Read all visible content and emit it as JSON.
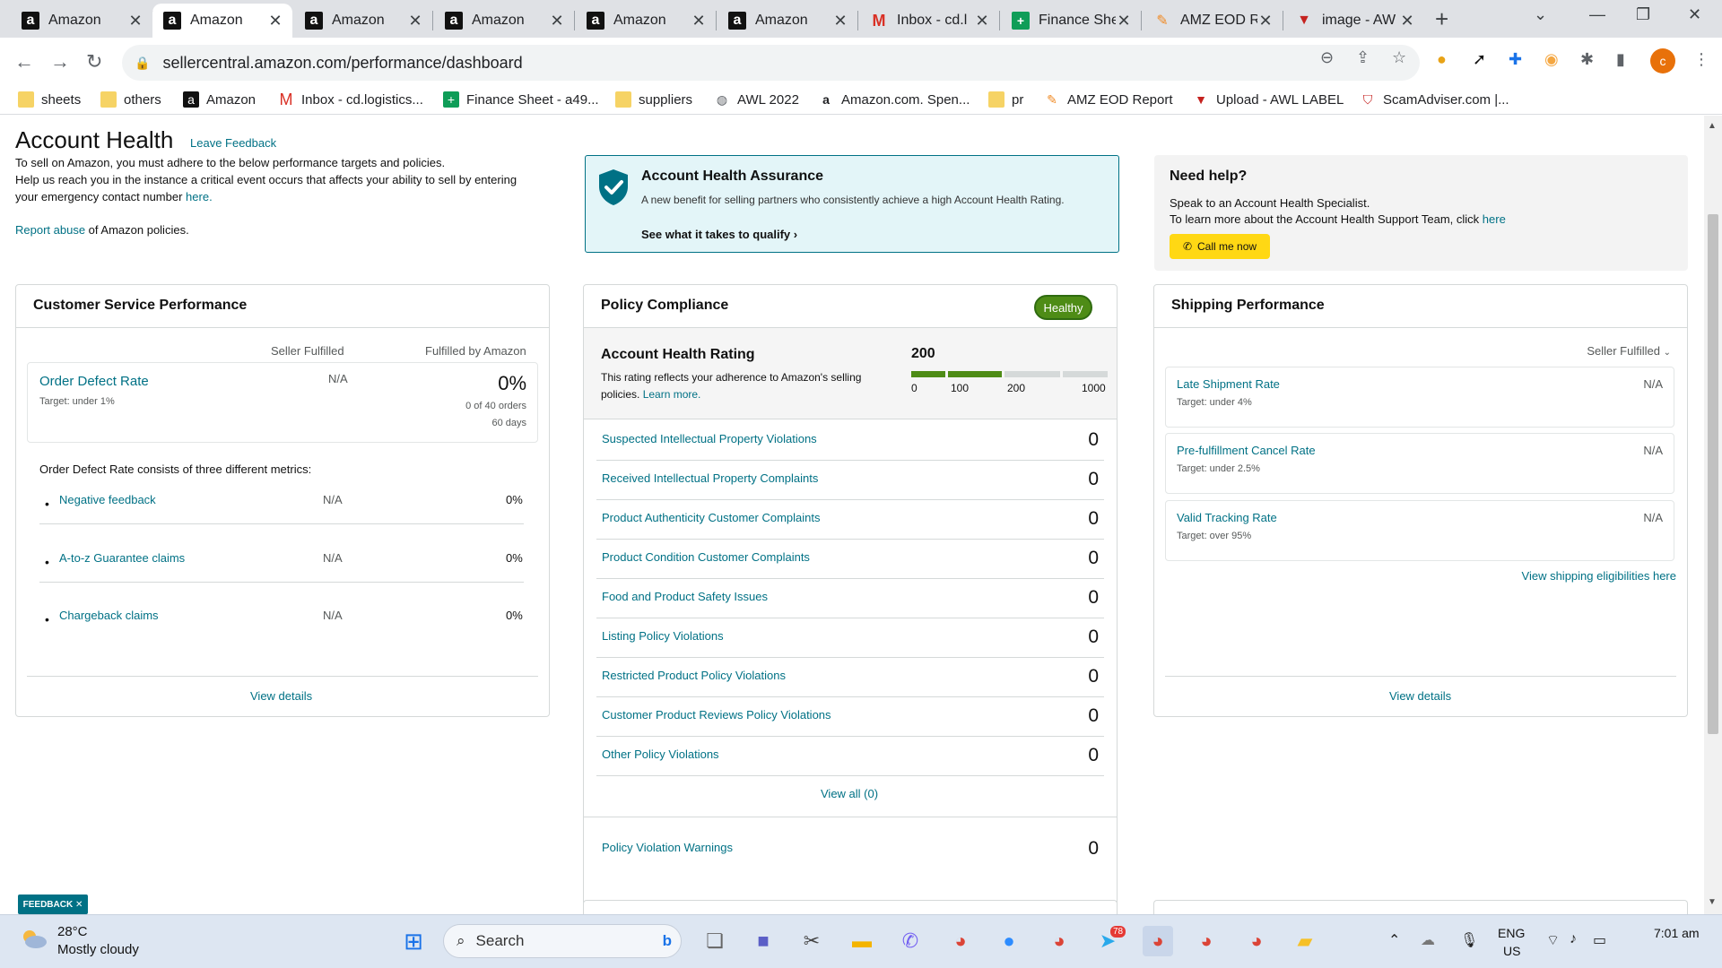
{
  "browser": {
    "tabs": [
      {
        "title": "Amazon",
        "icon": "amazon-logo",
        "active": false
      },
      {
        "title": "Amazon",
        "icon": "amazon-logo",
        "active": true
      },
      {
        "title": "Amazon",
        "icon": "amazon-logo",
        "active": false
      },
      {
        "title": "Amazon",
        "icon": "amazon-logo",
        "active": false
      },
      {
        "title": "Amazon",
        "icon": "amazon-logo",
        "active": false
      },
      {
        "title": "Amazon",
        "icon": "amazon-logo",
        "active": false
      },
      {
        "title": "Inbox - cd.l",
        "icon": "gmail-icon",
        "active": false
      },
      {
        "title": "Finance She",
        "icon": "sheets-icon",
        "active": false
      },
      {
        "title": "AMZ EOD R",
        "icon": "amz-eod-icon",
        "active": false
      },
      {
        "title": "image - AW",
        "icon": "awl-icon",
        "active": false
      }
    ],
    "url": "sellercentral.amazon.com/performance/dashboard",
    "profile_initial": "c",
    "bookmarks": [
      {
        "label": "sheets",
        "icon": "folder-icon"
      },
      {
        "label": "others",
        "icon": "folder-icon"
      },
      {
        "label": "Amazon",
        "icon": "amazon-logo"
      },
      {
        "label": "Inbox - cd.logistics...",
        "icon": "gmail-icon"
      },
      {
        "label": "Finance Sheet - a49...",
        "icon": "sheets-icon"
      },
      {
        "label": "suppliers",
        "icon": "folder-icon"
      },
      {
        "label": "AWL 2022",
        "icon": "globe-icon"
      },
      {
        "label": "Amazon.com. Spen...",
        "icon": "amazon-a-icon"
      },
      {
        "label": "pr",
        "icon": "folder-icon"
      },
      {
        "label": "AMZ EOD Report",
        "icon": "amz-eod-icon"
      },
      {
        "label": "Upload - AWL LABEL",
        "icon": "awl-icon"
      },
      {
        "label": "ScamAdviser.com |...",
        "icon": "scamadviser-icon"
      }
    ]
  },
  "header": {
    "title": "Account Health",
    "leave_feedback": "Leave Feedback",
    "intro_line1": "To sell on Amazon, you must adhere to the below performance targets and policies.",
    "intro_line2": "Help us reach you in the instance a critical event occurs that affects your ability to sell by entering",
    "intro_line3_prefix": "your emergency contact number ",
    "intro_line3_link": "here.",
    "report_abuse_link": "Report abuse",
    "report_abuse_suffix": " of Amazon policies."
  },
  "assurance": {
    "title": "Account Health Assurance",
    "description": "A new benefit for selling partners who consistently achieve a high Account Health Rating.",
    "link": "See what it takes to qualify",
    "link_icon": "chevron-right-icon"
  },
  "help": {
    "title": "Need help?",
    "line1": "Speak to an Account Health Specialist.",
    "line2_prefix": "To learn more about the Account Health Support Team, click ",
    "line2_link": "here",
    "call_button": "Call me now"
  },
  "customer_service": {
    "title": "Customer Service Performance",
    "col_seller": "Seller Fulfilled",
    "col_fba": "Fulfilled by Amazon",
    "odr_title": "Order Defect Rate",
    "odr_target": "Target: under 1%",
    "odr_seller": "N/A",
    "odr_fba": "0%",
    "odr_orders": "0 of 40 orders",
    "odr_days": "60 days",
    "metrics_intro": "Order Defect Rate consists of three different metrics:",
    "metrics": [
      {
        "label": "Negative feedback",
        "seller": "N/A",
        "fba": "0%"
      },
      {
        "label": "A-to-z Guarantee claims",
        "seller": "N/A",
        "fba": "0%"
      },
      {
        "label": "Chargeback claims",
        "seller": "N/A",
        "fba": "0%"
      }
    ],
    "view_details": "View details"
  },
  "policy": {
    "title": "Policy Compliance",
    "status_badge": "Healthy",
    "ahr_title": "Account Health Rating",
    "ahr_desc_prefix": "This rating reflects your adherence to Amazon's selling policies. ",
    "ahr_learn_more": "Learn more.",
    "ahr_score": "200",
    "scale_ticks": [
      "0",
      "100",
      "200",
      "1000"
    ],
    "scale_colors": {
      "filled": "#4e8c16",
      "empty": "#d5d9d9"
    },
    "rows": [
      {
        "label": "Suspected Intellectual Property Violations",
        "value": "0"
      },
      {
        "label": "Received Intellectual Property Complaints",
        "value": "0"
      },
      {
        "label": "Product Authenticity Customer Complaints",
        "value": "0"
      },
      {
        "label": "Product Condition Customer Complaints",
        "value": "0"
      },
      {
        "label": "Food and Product Safety Issues",
        "value": "0"
      },
      {
        "label": "Listing Policy Violations",
        "value": "0"
      },
      {
        "label": "Restricted Product Policy Violations",
        "value": "0"
      },
      {
        "label": "Customer Product Reviews Policy Violations",
        "value": "0"
      },
      {
        "label": "Other Policy Violations",
        "value": "0"
      }
    ],
    "view_all": "View all (0)",
    "warnings_label": "Policy Violation Warnings",
    "warnings_value": "0"
  },
  "shipping": {
    "title": "Shipping Performance",
    "dropdown": "Seller Fulfilled",
    "metrics": [
      {
        "title": "Late Shipment Rate",
        "target": "Target: under 4%",
        "value": "N/A"
      },
      {
        "title": "Pre-fulfillment Cancel Rate",
        "target": "Target: under 2.5%",
        "value": "N/A"
      },
      {
        "title": "Valid Tracking Rate",
        "target": "Target: over 95%",
        "value": "N/A"
      }
    ],
    "eligibility_link": "View shipping eligibilities here",
    "view_details": "View details"
  },
  "feedback_tab": "FEEDBACK ✕",
  "taskbar": {
    "temperature": "28°C",
    "weather": "Mostly cloudy",
    "search_label": "Search",
    "language": "ENG",
    "region": "US",
    "time": "7:01 am",
    "telegram_badge": "78"
  },
  "accent_colors": {
    "link": "#007185",
    "healthy": "#4e8c16",
    "call_button": "#ffd814"
  }
}
